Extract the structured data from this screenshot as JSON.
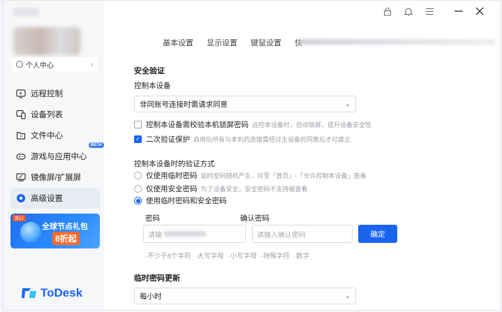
{
  "sidebar": {
    "personal_center": "个人中心",
    "items": [
      {
        "label": "远程控制",
        "icon": "remote-control-icon"
      },
      {
        "label": "设备列表",
        "icon": "device-list-icon"
      },
      {
        "label": "文件中心",
        "icon": "file-center-icon"
      },
      {
        "label": "游戏与应用中心",
        "icon": "gamepad-icon"
      },
      {
        "label": "镜像屏/扩展屏",
        "icon": "mirror-screen-icon"
      },
      {
        "label": "高级设置",
        "icon": "gear-icon",
        "active": true
      }
    ],
    "beta": "BETA",
    "promo": {
      "tag": "双12",
      "title": "全球节点礼包",
      "discount": "8折起"
    },
    "logo": "ToDesk"
  },
  "tabs": [
    "基本设置",
    "显示设置",
    "键鼠设置",
    "快"
  ],
  "security": {
    "title": "安全验证",
    "control_label": "控制本设备",
    "control_select": "非同账号连接时需请求同意",
    "opt_lockscreen": {
      "label": "控制本设备需校验本机锁屏密码",
      "hint": "远控本设备时，自动锁屏，提升设备安全性",
      "checked": false
    },
    "opt_2fa": {
      "label": "二次验证保护",
      "hint": "启用后所有与本机的连接需经过主设备的同意后才可建立",
      "checked": true
    }
  },
  "verify": {
    "title": "控制本设备时的验证方式",
    "options": [
      {
        "label": "仅使用临时密码",
        "hint": "临时密码随机产生，可至「首页」-「允许控制本设备」查看",
        "checked": false
      },
      {
        "label": "仅使用安全密码",
        "hint": "为了设备安全，安全密码不支持被查看",
        "checked": false
      },
      {
        "label": "使用临时密码和安全密码",
        "hint": "",
        "checked": true
      }
    ],
    "password_label": "密码",
    "password_placeholder": "请输",
    "confirm_label": "确认密码",
    "confirm_placeholder": "请输入确认密码",
    "confirm_button": "确定",
    "requirements": [
      "·不少于8个字符",
      "·大写字母",
      "·小写字母",
      "·特殊字符",
      "·数字"
    ]
  },
  "temp_update": {
    "title": "临时密码更新",
    "select": "每小时"
  },
  "colors": {
    "accent": "#1a64f0",
    "sidebar_bg": "#f6f7f9"
  }
}
